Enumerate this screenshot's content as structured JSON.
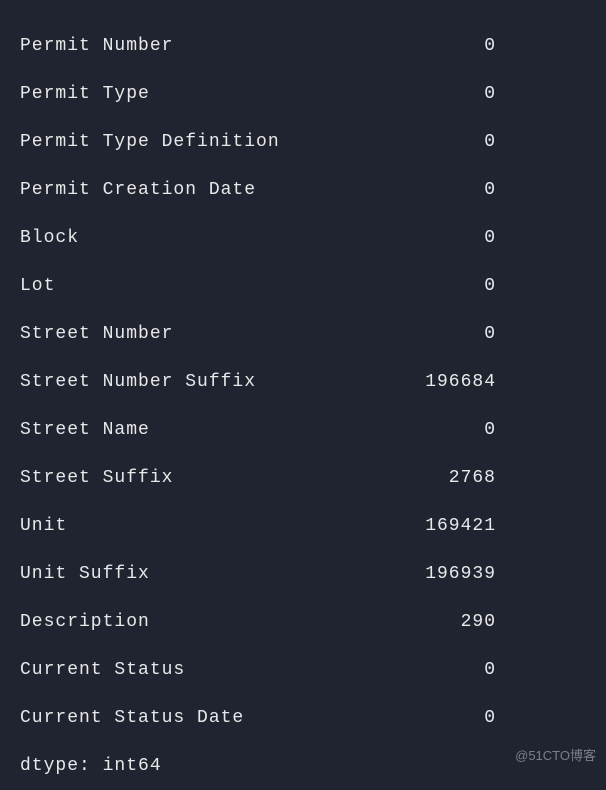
{
  "rows": [
    {
      "label": "Permit Number",
      "value": "0"
    },
    {
      "label": "Permit Type",
      "value": "0"
    },
    {
      "label": "Permit Type Definition",
      "value": "0"
    },
    {
      "label": "Permit Creation Date",
      "value": "0"
    },
    {
      "label": "Block",
      "value": "0"
    },
    {
      "label": "Lot",
      "value": "0"
    },
    {
      "label": "Street Number",
      "value": "0"
    },
    {
      "label": "Street Number Suffix",
      "value": "196684"
    },
    {
      "label": "Street Name",
      "value": "0"
    },
    {
      "label": "Street Suffix",
      "value": "2768"
    },
    {
      "label": "Unit",
      "value": "169421"
    },
    {
      "label": "Unit Suffix",
      "value": "196939"
    },
    {
      "label": "Description",
      "value": "290"
    },
    {
      "label": "Current Status",
      "value": "0"
    },
    {
      "label": "Current Status Date",
      "value": "0"
    }
  ],
  "dtype": "dtype: int64",
  "watermark": "@51CTO博客"
}
